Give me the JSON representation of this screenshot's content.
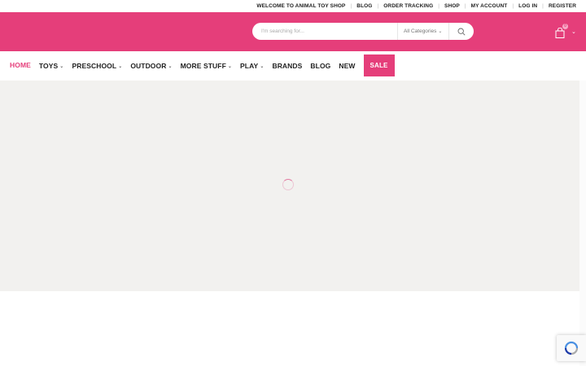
{
  "topbar": {
    "welcome": "WELCOME TO ANIMAL TOY SHOP",
    "links": [
      "BLOG",
      "ORDER TRACKING",
      "SHOP",
      "MY ACCOUNT",
      "LOG IN",
      "REGISTER"
    ]
  },
  "header": {
    "brand_color": "#e53e7a",
    "search_placeholder": "I'm searching for...",
    "category_label": "All Categories",
    "search_icon": "search-icon",
    "cart_count": "0",
    "cart_icon": "shopping-bag-icon"
  },
  "nav": {
    "items": [
      {
        "label": "HOME",
        "active": true,
        "dropdown": false
      },
      {
        "label": "TOYS",
        "dropdown": true
      },
      {
        "label": "PRESCHOOL",
        "dropdown": true
      },
      {
        "label": "OUTDOOR",
        "dropdown": true
      },
      {
        "label": "MORE STUFF",
        "dropdown": true
      },
      {
        "label": "PLAY",
        "dropdown": true
      },
      {
        "label": "BRANDS",
        "dropdown": false
      },
      {
        "label": "BLOG",
        "dropdown": false
      },
      {
        "label": "NEW",
        "dropdown": false
      }
    ],
    "sale_label": "SALE"
  },
  "content": {
    "background": "#f2f1ef",
    "loading_icon": "loading-spinner-icon"
  },
  "recaptcha_icon": "recaptcha-icon"
}
